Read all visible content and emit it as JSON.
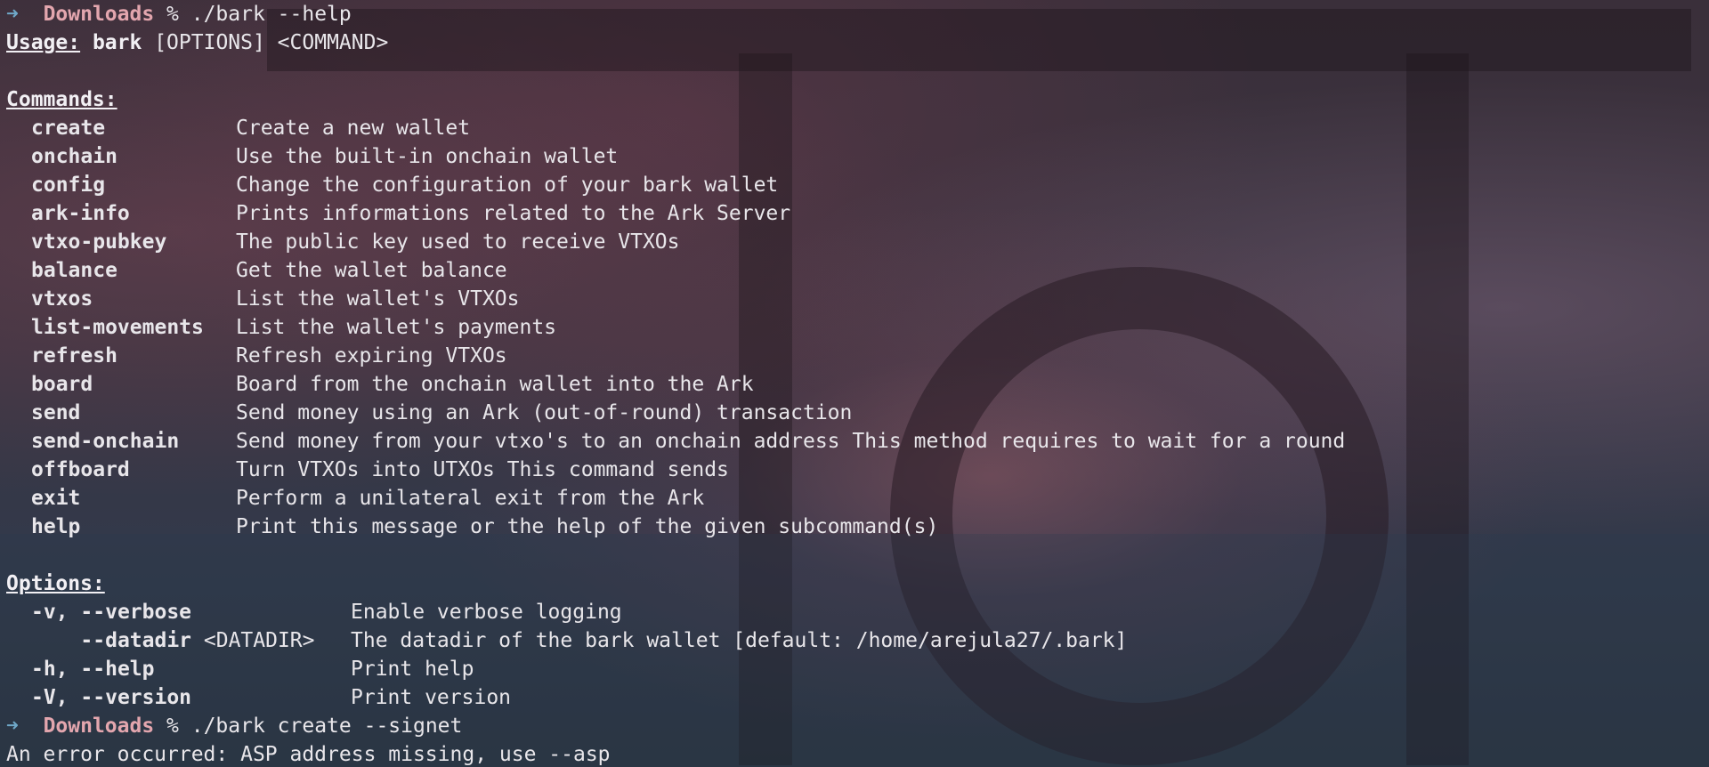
{
  "prompt": {
    "arrow": "➜",
    "directory": "Downloads"
  },
  "help_command": "% ./bark --help",
  "usage": {
    "label": "Usage:",
    "program": "bark",
    "args": "[OPTIONS] <COMMAND>"
  },
  "commands": {
    "heading": "Commands:",
    "items": [
      {
        "name": "create",
        "desc": "Create a new wallet"
      },
      {
        "name": "onchain",
        "desc": "Use the built-in onchain wallet"
      },
      {
        "name": "config",
        "desc": "Change the configuration of your bark wallet"
      },
      {
        "name": "ark-info",
        "desc": "Prints informations related to the Ark Server"
      },
      {
        "name": "vtxo-pubkey",
        "desc": "The public key used to receive VTXOs"
      },
      {
        "name": "balance",
        "desc": "Get the wallet balance"
      },
      {
        "name": "vtxos",
        "desc": "List the wallet's VTXOs"
      },
      {
        "name": "list-movements",
        "desc": "List the wallet's payments"
      },
      {
        "name": "refresh",
        "desc": "Refresh expiring VTXOs"
      },
      {
        "name": "board",
        "desc": "Board from the onchain wallet into the Ark"
      },
      {
        "name": "send",
        "desc": "Send money using an Ark (out-of-round) transaction"
      },
      {
        "name": "send-onchain",
        "desc": "Send money from your vtxo's to an onchain address This method requires to wait for a round"
      },
      {
        "name": "offboard",
        "desc": "Turn VTXOs into UTXOs This command sends"
      },
      {
        "name": "exit",
        "desc": "Perform a unilateral exit from the Ark"
      },
      {
        "name": "help",
        "desc": "Print this message or the help of the given subcommand(s)"
      }
    ]
  },
  "options": {
    "heading": "Options:",
    "items": [
      {
        "short": "-v,",
        "long": "--verbose",
        "value": "",
        "desc": "Enable verbose logging"
      },
      {
        "short": "   ",
        "long": "--datadir",
        "value": " <DATADIR>",
        "desc": "The datadir of the bark wallet [default: /home/arejula27/.bark]"
      },
      {
        "short": "-h,",
        "long": "--help",
        "value": "",
        "desc": "Print help"
      },
      {
        "short": "-V,",
        "long": "--version",
        "value": "",
        "desc": "Print version"
      }
    ]
  },
  "create_command": "% ./bark create --signet",
  "error_output": "An error occurred: ASP address missing, use --asp"
}
